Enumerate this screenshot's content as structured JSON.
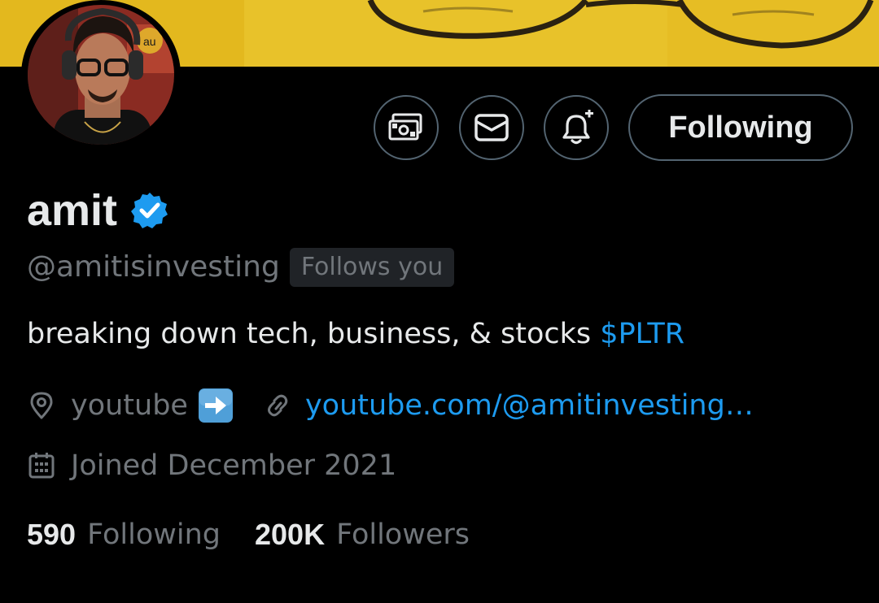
{
  "banner": {
    "background_color": "#e8c22a"
  },
  "avatar": {
    "sign_text": "au"
  },
  "actions": {
    "tip_icon": "money-icon",
    "message_icon": "envelope-icon",
    "notify_icon": "bell-plus-icon",
    "following_label": "Following"
  },
  "profile": {
    "name": "amit",
    "verified_icon": "verified-badge-icon",
    "handle": "@amitisinvesting",
    "follows_you": "Follows you",
    "bio_text": "breaking down tech, business, & stocks ",
    "bio_cashtag": "$PLTR",
    "location": "youtube",
    "location_emoji": "right-arrow-emoji",
    "website": "youtube.com/@amitinvesting…",
    "joined": "Joined December 2021"
  },
  "stats": {
    "following_count": "590",
    "following_label": "Following",
    "followers_count": "200K",
    "followers_label": "Followers"
  },
  "colors": {
    "background": "#000000",
    "primary_text": "#e7e9ea",
    "secondary_text": "#71767b",
    "accent": "#1d9bf0",
    "border": "#536471"
  }
}
